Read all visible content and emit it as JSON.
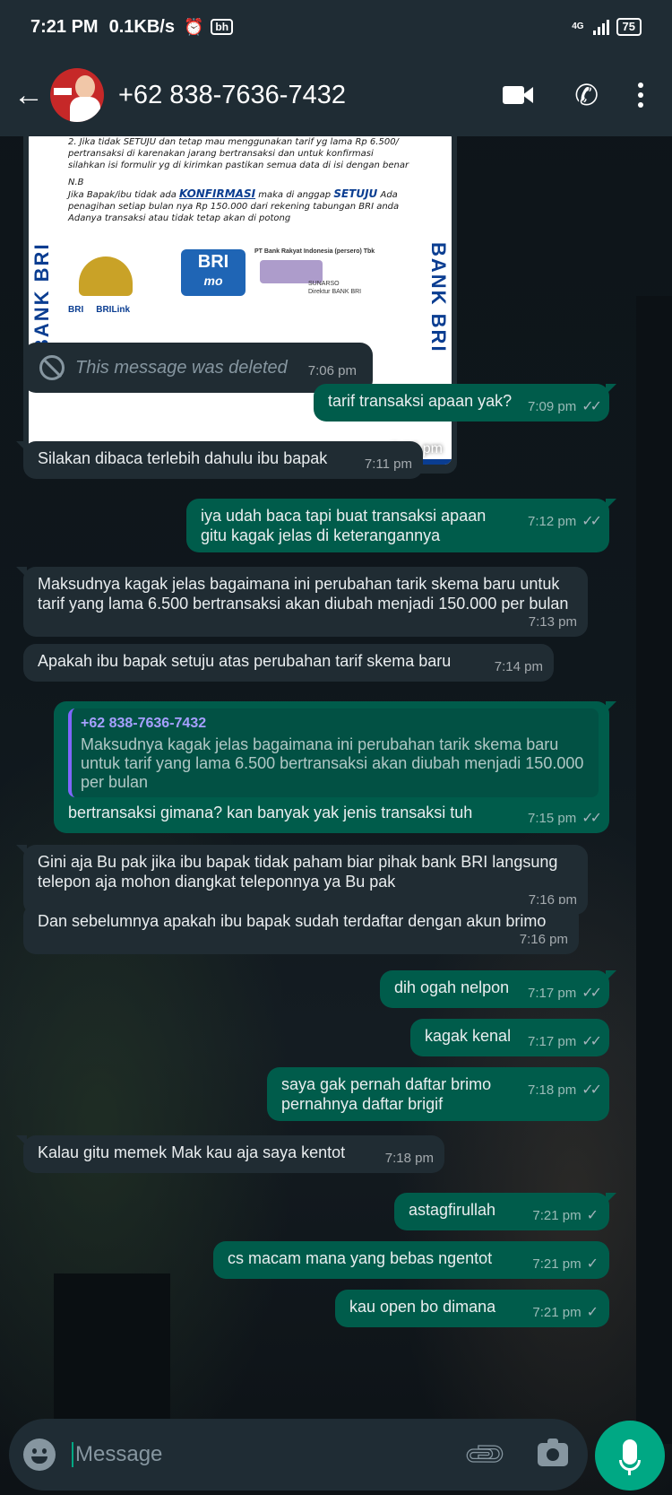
{
  "status_bar": {
    "time": "7:21 PM",
    "speed": "0.1KB/s",
    "alarm_icon": "alarm-icon",
    "app_badge": "bh",
    "network": "4G",
    "battery": "75"
  },
  "header": {
    "contact_name": "+62 838-7636-7432"
  },
  "image_message": {
    "doc_line1": "2. Jika tidak SETUJU dan tetap mau menggunakan tarif yg lama Rp 6.500/ pertransaksi di karenakan jarang bertransaksi dan untuk konfirmasi silahkan isi formulir yg di kirimkan pastikan semua data di isi dengan benar",
    "doc_nb": "N.B",
    "doc_line2a": "Jika Bapak/ibu tidak ada ",
    "doc_konfirmasi": "KONFIRMASI",
    "doc_line2b": " maka di anggap ",
    "doc_setuju": "SETUJU",
    "doc_line2c": " Ada penagihan setiap bulan nya Rp 150.000 dari rekening tabungan BRI anda Adanya transaksi atau tidak tetap akan di potong",
    "brimo_top": "BRI",
    "brimo_bottom": "mo",
    "side_text": "BANK BRI",
    "stamp_text": "PT Bank Rakyat Indonesia (persero) Tbk",
    "stamp_name": "SUNARSO",
    "stamp_title": "Direktur BANK BRI",
    "foot_bri": "BRI",
    "foot_brilink": "BRILink",
    "time": "7:06 pm"
  },
  "messages": [
    {
      "dir": "in",
      "deleted": true,
      "text": "This message was deleted",
      "time": "7:06 pm"
    },
    {
      "dir": "out",
      "text": "tarif transaksi apaan yak?",
      "time": "7:09 pm",
      "ticks": "✓✓"
    },
    {
      "dir": "in",
      "text": "Silakan dibaca terlebih dahulu ibu bapak",
      "time": "7:11 pm"
    },
    {
      "dir": "out",
      "text": "iya udah baca tapi buat transaksi apaan gitu kagak jelas di keterangannya",
      "time": "7:12 pm",
      "ticks": "✓✓"
    },
    {
      "dir": "in",
      "text": "Maksudnya kagak jelas bagaimana ini perubahan tarik skema baru untuk tarif yang lama 6.500 bertransaksi akan diubah menjadi 150.000 per bulan",
      "time": "7:13 pm"
    },
    {
      "dir": "in",
      "text": "Apakah ibu bapak setuju atas perubahan tarif skema baru",
      "time": "7:14 pm"
    },
    {
      "dir": "out",
      "quote_name": "+62 838-7636-7432",
      "quote_text": "Maksudnya kagak jelas bagaimana ini perubahan tarik skema baru untuk tarif yang lama 6.500 bertransaksi akan diubah menjadi 150.000 per bulan",
      "text": "bertransaksi gimana? kan banyak yak jenis transaksi tuh",
      "time": "7:15 pm",
      "ticks": "✓✓"
    },
    {
      "dir": "in",
      "text": "Gini aja Bu pak jika ibu bapak tidak paham biar pihak bank BRI langsung telepon aja mohon diangkat teleponnya ya Bu pak",
      "time": "7:16 pm"
    },
    {
      "dir": "in",
      "text": "Dan sebelumnya apakah ibu bapak sudah terdaftar dengan akun brimo",
      "time": "7:16 pm"
    },
    {
      "dir": "out",
      "text": "dih ogah nelpon",
      "time": "7:17 pm",
      "ticks": "✓✓"
    },
    {
      "dir": "out",
      "text": "kagak kenal",
      "time": "7:17 pm",
      "ticks": "✓✓"
    },
    {
      "dir": "out",
      "text": "saya gak pernah daftar brimo pernahnya daftar brigif",
      "time": "7:18 pm",
      "ticks": "✓✓"
    },
    {
      "dir": "in",
      "text": "Kalau gitu memek Mak kau aja saya kentot",
      "time": "7:18 pm"
    },
    {
      "dir": "out",
      "text": "astagfirullah",
      "time": "7:21 pm",
      "ticks": "✓"
    },
    {
      "dir": "out",
      "text": "cs macam mana yang bebas ngentot",
      "time": "7:21 pm",
      "ticks": "✓"
    },
    {
      "dir": "out",
      "text": "kau open bo dimana",
      "time": "7:21 pm",
      "ticks": "✓"
    }
  ],
  "input": {
    "placeholder": "Message"
  },
  "colors": {
    "bubble_out": "#005c4b",
    "bubble_in": "#202c33",
    "accent": "#00a884",
    "header": "#1f2c34"
  }
}
